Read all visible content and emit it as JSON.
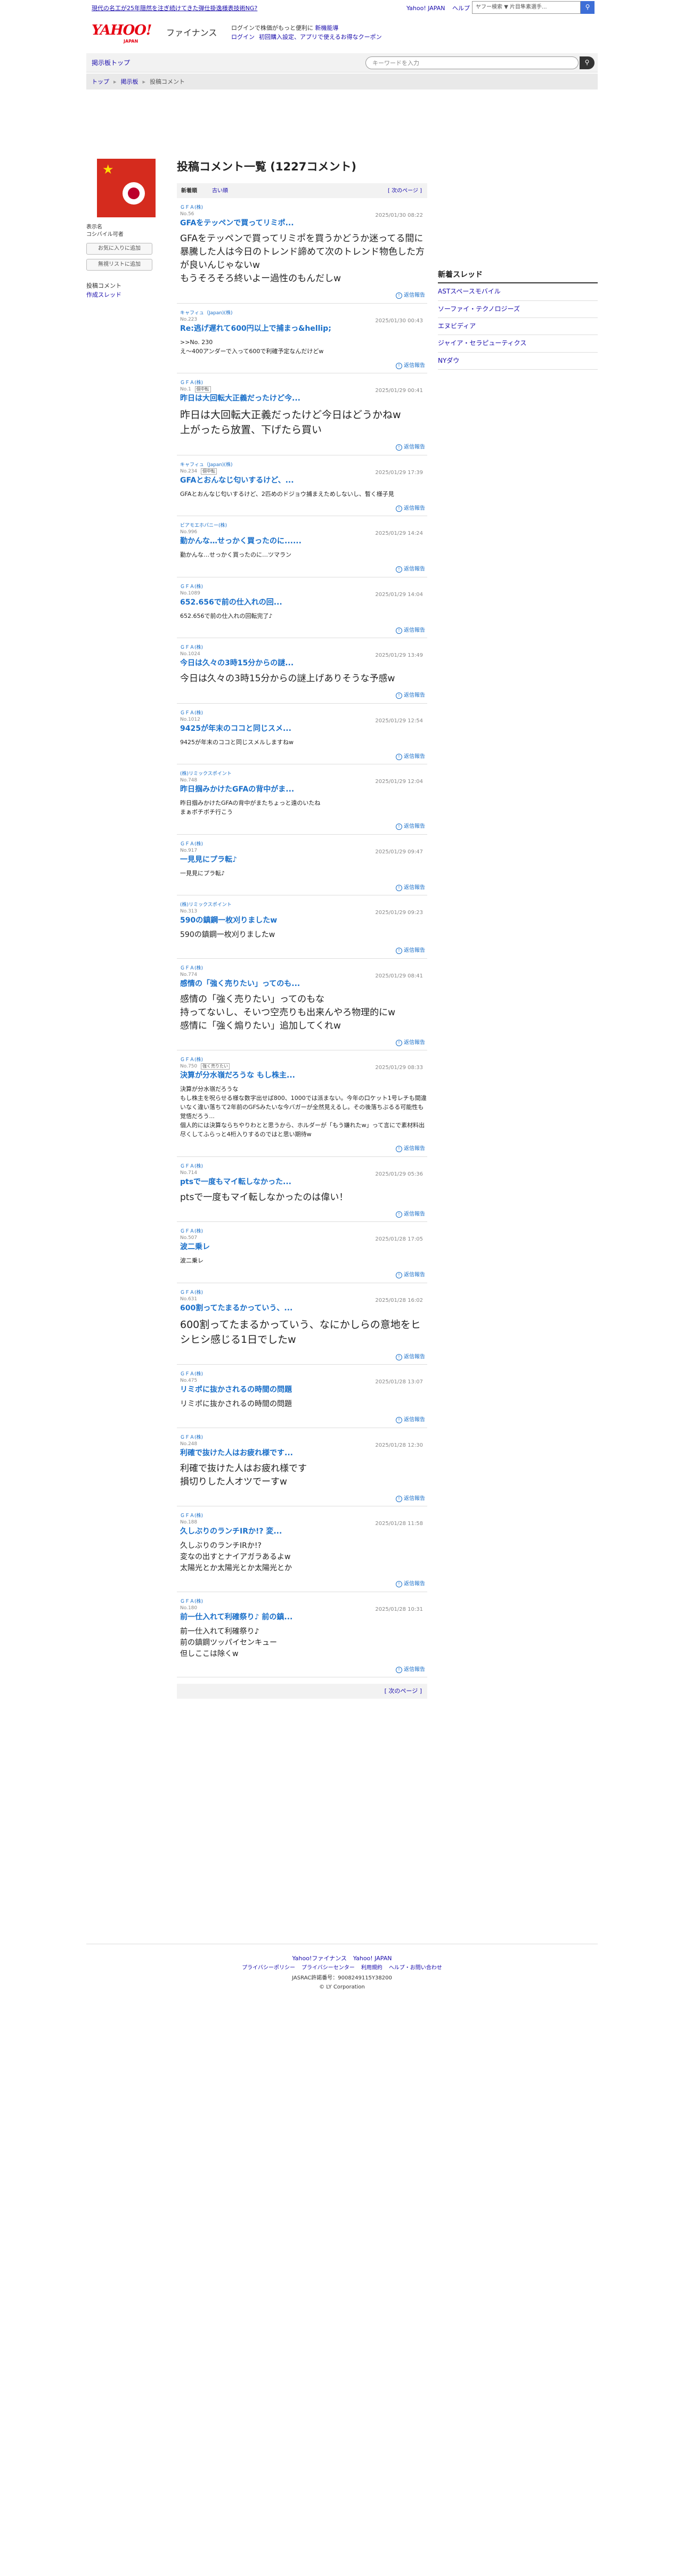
{
  "topbar": {
    "promo": "現代の名工が25年隠然を注ぎ続けてきた弾仕掛逸様表技術NG?",
    "links": [
      "Yahoo! JAPAN",
      "ヘルプ"
    ],
    "search_placeholder": "ヤフー検索",
    "search_select": "▼ 片目隼素選手..."
  },
  "header": {
    "logo": "YAHOO!",
    "logo_sub": "JAPAN",
    "service": "ファイナンス",
    "line1_prefix": "ログインで株価がもっと便利に",
    "line1_link": "新機能導",
    "line2_link1": "ログイン",
    "line2_link2": "初回購入設定、アプリで使えるお得なクーポン"
  },
  "nav": {
    "home": "掲示板トップ",
    "keyword_placeholder": "キーワードを入力"
  },
  "breadcrumb": [
    "トップ",
    "掲示板",
    "投稿コメント"
  ],
  "profile": {
    "name_label": "表示名",
    "name_value": "コシバイル可者",
    "follow_button": "お気に入りに追加",
    "ignore_button": "無視リストに追加",
    "menu_current": "投稿コメント",
    "menu_link": "作成スレッド"
  },
  "main": {
    "title": "投稿コメント一覧 (1227コメント)",
    "tab_new": "新着順",
    "tab_old": "古い順",
    "next_page": "[ 次のページ ]",
    "reply_label": "返信報告"
  },
  "comments": [
    {
      "user": "ＧＦＡ(株)",
      "no": "No.56",
      "date": "2025/01/30 08:22",
      "badge": "",
      "title": "GFAをテッペンで買ってリミポ...",
      "body": "GFAをテッペンで買ってリミポを買うかどうか迷ってる間に暴騰した人は今日のトレンド諦めて次のトレンド物色した方が良いんじゃないw\nもうそろそろ終いよー過性のもんだしw",
      "size": "lg"
    },
    {
      "user": "キャフィュ（Japan)(株)",
      "no": "No.223",
      "date": "2025/01/30 00:43",
      "badge": "",
      "title": "Re:逃げ遅れて600円以上で捕まっ&hellip;",
      "body": ">>No. 230\nえ〜400アンダーで入って600で利確予定なんだけどw",
      "size": "sm"
    },
    {
      "user": "ＧＦＡ(株)",
      "no": "No.1",
      "date": "2025/01/29 00:41",
      "badge": "個中転",
      "title": "昨日は大回転大正義だったけど今...",
      "body": "昨日は大回転大正義だったけど今日はどうかねw\n上がったら放置、下げたら買い",
      "size": "xl"
    },
    {
      "user": "キャフィュ（Japan)(株)",
      "no": "No.234",
      "date": "2025/01/29 17:39",
      "badge": "個中転",
      "title": "GFAとおんなじ匂いするけど、...",
      "body": "GFAとおんなじ匂いするけど、2匹めのドジョウ捕まえためしないし、暫く様子見",
      "size": "sm"
    },
    {
      "user": "ビアモエホパニー(株)",
      "no": "No.996",
      "date": "2025/01/29 14:24",
      "badge": "",
      "title": "勤かんな…せっかく買ったのに......",
      "body": "勤かんな…せっかく買ったのに…ツマラン",
      "size": "sm"
    },
    {
      "user": "ＧＦＡ(株)",
      "no": "No.1089",
      "date": "2025/01/29 14:04",
      "badge": "",
      "title": "652.656で前の仕入れの回...",
      "body": "652.656で前の仕入れの回転完了♪",
      "size": "sm"
    },
    {
      "user": "ＧＦＡ(株)",
      "no": "No.1024",
      "date": "2025/01/29 13:49",
      "badge": "",
      "title": "今日は久々の3時15分からの謎...",
      "body": "今日は久々の3時15分からの謎上げありそうな予感w",
      "size": "lg"
    },
    {
      "user": "ＧＦＡ(株)",
      "no": "No.1012",
      "date": "2025/01/29 12:54",
      "badge": "",
      "title": "9425が年末のココと同じスメ...",
      "body": "9425が年末のココと同じスメルしますねw",
      "size": "sm"
    },
    {
      "user": "(株)リミックスポイント",
      "no": "No.748",
      "date": "2025/01/29 12:04",
      "badge": "",
      "title": "昨日掴みかけたGFAの背中がま...",
      "body": "昨日掴みかけたGFAの背中がまたちょっと遠のいたね\nまぁボチボチ行こう",
      "size": "sm"
    },
    {
      "user": "ＧＦＡ(株)",
      "no": "No.917",
      "date": "2025/01/29 09:47",
      "badge": "",
      "title": "一見見にプラ転♪",
      "body": "一見見にプラ転♪",
      "size": "sm"
    },
    {
      "user": "(株)リミックスポイント",
      "no": "No.313",
      "date": "2025/01/29 09:23",
      "badge": "",
      "title": "590の鎮鋼一枚刈りましたw",
      "body": "590の鎮鋼一枚刈りましたw",
      "size": "md"
    },
    {
      "user": "ＧＦＡ(株)",
      "no": "No.774",
      "date": "2025/01/29 08:41",
      "badge": "",
      "title": "感情の「強く売りたい」ってのも...",
      "body": "感情の「強く売りたい」ってのもな\n持ってないし、そいつ空売りも出来んやろ物理的にw\n感情に「強く煽りたい」追加してくれw",
      "size": "lg"
    },
    {
      "user": "ＧＦＡ(株)",
      "no": "No.750",
      "date": "2025/01/29 08:33",
      "badge": "強く売りたい",
      "title": "決算が分水嶺だろうな もし株主...",
      "body": "決算が分水嶺だろうな\nもし株主を呪らせる様な数字出せば800、1000では派まない。今年の口ケット1号レチも間違いなく違い落ちて2年前のGFSみたいな今バガーが全然見えるし。その後落ちぶるる可能性も覚悟だろう...\n個人的には決算ならちやりわとと思うから、ホルダーが「もう嫌れたw」って言にで素材料出尽くしてふらっと4桁入りするのではと思い期待w",
      "size": "sm"
    },
    {
      "user": "ＧＦＡ(株)",
      "no": "No.714",
      "date": "2025/01/29 05:36",
      "badge": "",
      "title": "ptsで一度もマイ転しなかった...",
      "body": "ptsで一度もマイ転しなかったのは偉い！",
      "size": "lg"
    },
    {
      "user": "ＧＦＡ(株)",
      "no": "No.507",
      "date": "2025/01/28 17:05",
      "badge": "",
      "title": "波二乗レ",
      "body": "波二乗レ",
      "size": "sm"
    },
    {
      "user": "ＧＦＡ(株)",
      "no": "No.631",
      "date": "2025/01/28 16:02",
      "badge": "",
      "title": "600割ってたまるかっていう、...",
      "body": "600割ってたまるかっていう、なにかしらの意地をヒシヒシ感じる1日でしたw",
      "size": "xl"
    },
    {
      "user": "ＧＦＡ(株)",
      "no": "No.475",
      "date": "2025/01/28 13:07",
      "badge": "",
      "title": "リミポに抜かされるの時間の問題",
      "body": "リミポに抜かされるの時間の問題",
      "size": "md"
    },
    {
      "user": "ＧＦＡ(株)",
      "no": "No.248",
      "date": "2025/01/28 12:30",
      "badge": "",
      "title": "利確で抜けた人はお疲れ様です...",
      "body": "利確で抜けた人はお疲れ様です\n損切りした人オツでーすw",
      "size": "lg"
    },
    {
      "user": "ＧＦＡ(株)",
      "no": "No.188",
      "date": "2025/01/28 11:58",
      "badge": "",
      "title": "久しぶりのランチIRか!? 変...",
      "body": "久しぶりのランチIRか!?\n変なの出すとナイアガラあるよw\n太陽光とか太陽光とか太陽光とか",
      "size": "md"
    },
    {
      "user": "ＧＦＡ(株)",
      "no": "No.180",
      "date": "2025/01/28 10:31",
      "badge": "",
      "title": "前一仕入れて利確祭り♪ 前の鎮...",
      "body": "前一仕入れて利確祭り♪\n前の鎮鋼ツッパイセンキュー\n但しここは除くw",
      "size": "md"
    }
  ],
  "sidebar": {
    "heading": "新着スレッド",
    "threads": [
      "ASTスペースモバイル",
      "ソーファイ・テクノロジーズ",
      "エヌビディア",
      "ジャイア・セラピューティクス",
      "NYダウ"
    ]
  },
  "footer": {
    "links1": [
      "Yahoo!ファイナンス",
      "Yahoo! JAPAN"
    ],
    "links2": [
      "プライバシーポリシー",
      "プライバシーセンター",
      "利用規約",
      "ヘルプ・お問い合わせ"
    ],
    "license": "JASRAC許諾番号：9008249115Y38200",
    "copyright": "© LY Corporation"
  }
}
